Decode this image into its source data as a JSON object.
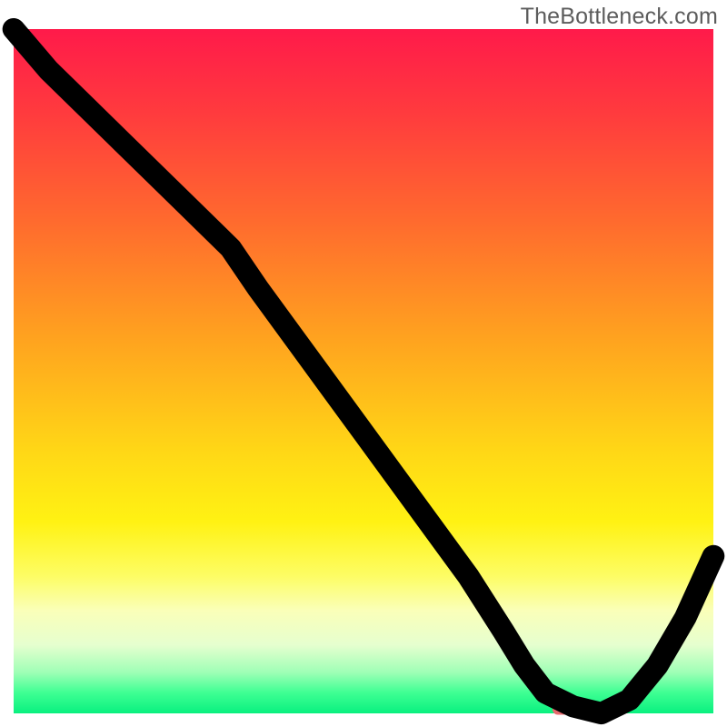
{
  "watermark": "TheBottleneck.com",
  "chart_data": {
    "type": "line",
    "title": "",
    "xlabel": "",
    "ylabel": "",
    "xlim": [
      0,
      100
    ],
    "ylim": [
      0,
      100
    ],
    "x": [
      0,
      5,
      10,
      15,
      20,
      25,
      31,
      35,
      40,
      45,
      50,
      55,
      60,
      65,
      70,
      73,
      76,
      80,
      84,
      88,
      92,
      96,
      100
    ],
    "values": [
      100,
      94,
      89,
      84,
      79,
      74,
      68,
      62,
      55,
      48,
      41,
      34,
      27,
      20,
      12,
      7,
      3,
      1,
      0,
      2,
      7,
      14,
      23
    ],
    "highlight_segment": {
      "x_start": 77,
      "x_end": 84,
      "y": 0.6
    },
    "background_gradient": {
      "top": "#ff1a4a",
      "mid": "#ffd816",
      "bottom": "#09f07f"
    }
  }
}
